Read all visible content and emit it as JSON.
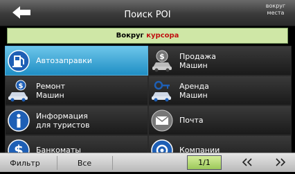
{
  "header": {
    "title": "Поиск POI",
    "around_button": "вокруг места",
    "back_icon": "back-arrow-icon"
  },
  "banner": {
    "prefix": "Вокруг ",
    "highlight": "курсора"
  },
  "categories": [
    {
      "label": "Автозаправки",
      "icon": "fuel-pump-icon",
      "selected": true
    },
    {
      "label": "Продажа\nМашин",
      "icon": "car-sale-icon",
      "selected": false
    },
    {
      "label": "Ремонт\nМашин",
      "icon": "car-repair-icon",
      "selected": false
    },
    {
      "label": "Аренда\nМашин",
      "icon": "car-rental-icon",
      "selected": false
    },
    {
      "label": "Информация\nдля туристов",
      "icon": "info-icon",
      "selected": false
    },
    {
      "label": "Почта",
      "icon": "mail-icon",
      "selected": false
    },
    {
      "label": "Банкоматы",
      "icon": "dollar-icon",
      "selected": false
    },
    {
      "label": "Компании",
      "icon": "company-icon",
      "selected": false
    }
  ],
  "footer": {
    "filter": "Фильтр",
    "all": "Все",
    "page": "1/1",
    "prev_icon": "double-chevron-left-icon",
    "next_icon": "double-chevron-right-icon"
  },
  "colors": {
    "selected_cell": "#2f9fd4",
    "banner_bg": "#cfe7a6",
    "highlight": "#c01010"
  }
}
